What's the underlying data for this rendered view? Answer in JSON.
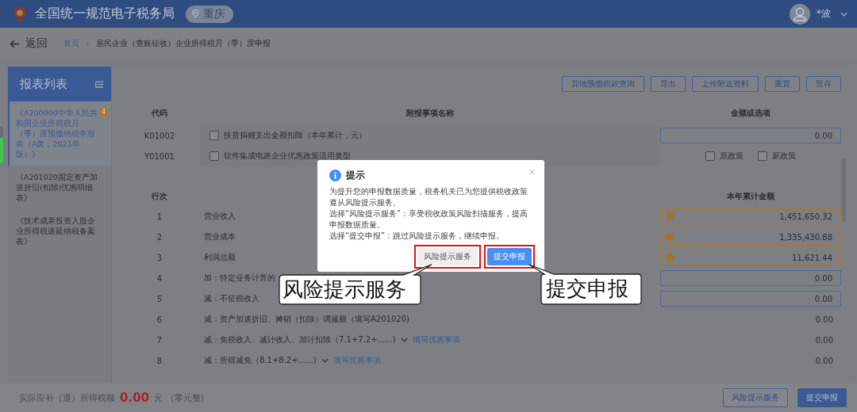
{
  "header": {
    "site_title": "全国统一规范电子税务局",
    "location": "重庆",
    "user_name": "*波"
  },
  "nav": {
    "back": "返回",
    "breadcrumb": [
      "首页",
      "居民企业（查账征收）企业所得税月（季）度申报"
    ]
  },
  "sidebar": {
    "title": "报表列表",
    "items": [
      {
        "label": "《A200000中华人民共和国企业所得税月（季）度预缴纳税申报表（A类，2021年版）》",
        "selected": true,
        "badge": "4"
      },
      {
        "label": "《A201020固定资产加速折旧(扣除)优惠明细表》",
        "selected": false
      },
      {
        "label": "《技术成果投资入股企业所得税递延纳税备案表》",
        "selected": false
      }
    ]
  },
  "toolbar": [
    "异地预缴税款查询",
    "导出",
    "上传附送资料",
    "重置",
    "暂存"
  ],
  "attach_table": {
    "columns": [
      "代码",
      "附报事项名称",
      "金额或选项"
    ],
    "rows": [
      {
        "code": "K01002",
        "label": "扶贫捐赠支出全额扣除（本年累计，元）",
        "checked": false,
        "kind": "input",
        "value": "0.00"
      },
      {
        "code": "Y01001",
        "label": "软件集成电路企业优惠政策适用类型",
        "checked": false,
        "kind": "options",
        "options": [
          {
            "label": "原政策",
            "checked": false
          },
          {
            "label": "新政策",
            "checked": false
          }
        ]
      }
    ]
  },
  "main_table": {
    "line_header": "行次",
    "amount_header": "本年累计金额",
    "rows": [
      {
        "line": "1",
        "label": "营业收入",
        "kind": "warning",
        "value": "1,451,650.32"
      },
      {
        "line": "2",
        "label": "营业成本",
        "kind": "warning",
        "value": "1,335,430.88"
      },
      {
        "line": "3",
        "label": "利润总额",
        "kind": "warning",
        "value": "11,621.44"
      },
      {
        "line": "4",
        "label": "加：特定业务计算的",
        "kind": "input",
        "value": "0.00"
      },
      {
        "line": "5",
        "label": "减：不征税收入",
        "kind": "input",
        "value": "0.00"
      },
      {
        "line": "6",
        "label": "减：资产加速折旧、摊销（扣除）调减额（填写A201020)",
        "kind": "text",
        "value": "0.00"
      },
      {
        "line": "7",
        "label": "减：免税收入、减计收入、加计扣除（7.1+7.2+......)",
        "expandable": true,
        "link": "填写优惠事项",
        "kind": "text",
        "value": "0.00"
      },
      {
        "line": "8",
        "label": "减：所得减免（8.1+8.2+......)",
        "expandable": true,
        "link": "填写优惠事项",
        "kind": "text",
        "value": "0.00"
      }
    ]
  },
  "footer": {
    "label": "实际应补（退）所得税额",
    "amount": "0.00",
    "unit": "元",
    "amount_words": "（零元整)",
    "buttons": [
      {
        "label": "风险提示服务",
        "kind": "outline"
      },
      {
        "label": "提交申报",
        "kind": "primary"
      }
    ]
  },
  "dialog": {
    "title": "提示",
    "paragraphs": [
      "为提升您的申报数据质量，税务机关已为您提供税收政策遵从风险提示服务。",
      "选择“风险提示服务”：享受税收政策风险扫描服务，提高申报数据质量。",
      "选择“提交申报”：跳过风险提示服务，继续申报。"
    ],
    "buttons": [
      {
        "label": "风险提示服务",
        "kind": "default",
        "highlighted": true
      },
      {
        "label": "提交申报",
        "kind": "primary",
        "highlighted": true
      }
    ]
  },
  "callouts": [
    {
      "text": "风险提示服务",
      "kind": "left"
    },
    {
      "text": "提交申报",
      "kind": "right"
    }
  ]
}
